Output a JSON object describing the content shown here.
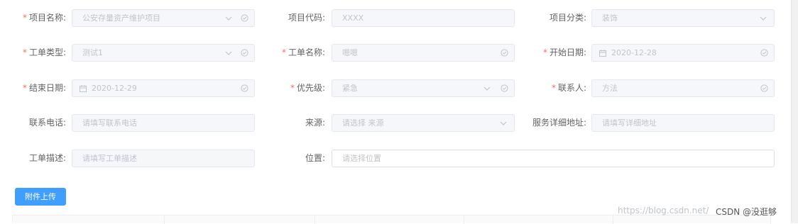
{
  "form": {
    "project_name": {
      "label": "项目名称:",
      "required": true,
      "value": "公安存量资产维护项目",
      "icons": [
        "chevron-down-icon",
        "circle-check-icon"
      ]
    },
    "project_code": {
      "label": "项目代码:",
      "required": false,
      "value": "XXXX"
    },
    "project_category": {
      "label": "项目分类:",
      "required": false,
      "value": "装饰",
      "icons": [
        "chevron-down-icon"
      ]
    },
    "work_order_type": {
      "label": "工单类型:",
      "required": true,
      "value": "测试1",
      "icons": [
        "chevron-down-icon",
        "circle-check-icon"
      ]
    },
    "work_order_name": {
      "label": "工单名称:",
      "required": true,
      "value": "嗯嗯",
      "icons": [
        "circle-check-icon"
      ]
    },
    "start_date": {
      "label": "开始日期:",
      "required": true,
      "value": "2020-12-28",
      "icons": [
        "calendar-icon",
        "circle-check-icon"
      ]
    },
    "end_date": {
      "label": "结束日期:",
      "required": true,
      "value": "2020-12-29",
      "icons": [
        "calendar-icon",
        "circle-check-icon"
      ]
    },
    "priority": {
      "label": "优先级:",
      "required": true,
      "value": "紧急",
      "icons": [
        "chevron-down-icon",
        "circle-check-icon"
      ]
    },
    "contact": {
      "label": "联系人:",
      "required": true,
      "value": "方法",
      "icons": [
        "circle-check-icon"
      ]
    },
    "contact_phone": {
      "label": "联系电话:",
      "required": false,
      "placeholder": "请填写联系电话"
    },
    "source": {
      "label": "来源:",
      "required": false,
      "placeholder": "请选择 来源",
      "icons": [
        "chevron-down-icon"
      ]
    },
    "service_address": {
      "label": "服务详细地址:",
      "required": false,
      "placeholder": "请填写详细地址"
    },
    "work_order_desc": {
      "label": "工单描述:",
      "required": false,
      "placeholder": "请填写工单描述"
    },
    "location": {
      "label": "位置:",
      "required": false,
      "placeholder": "请选择位置"
    }
  },
  "upload_button": {
    "label": "附件上传"
  },
  "watermark": {
    "url": "https://blog.csdn.net/",
    "csdn": "CSDN @没逛够"
  },
  "colors": {
    "required": "#f56c6c",
    "primary": "#409eff",
    "disabled_bg": "#f5f7fa",
    "placeholder": "#c0c4cc"
  }
}
